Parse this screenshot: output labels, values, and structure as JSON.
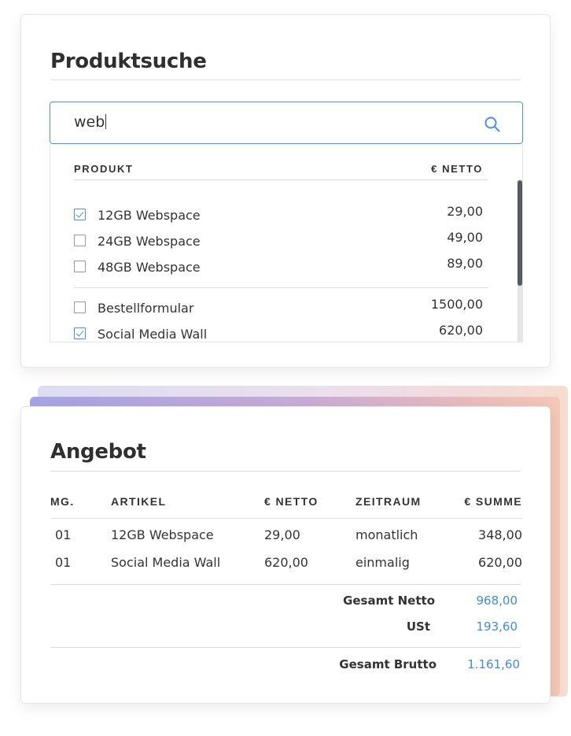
{
  "search": {
    "title": "Produktsuche",
    "query": "web",
    "columns": {
      "product": "PRODUKT",
      "price": "€ NETTO"
    },
    "results": [
      {
        "name": "12GB Webspace",
        "price": "29,00",
        "checked": true
      },
      {
        "name": "24GB Webspace",
        "price": "49,00",
        "checked": false
      },
      {
        "name": "48GB Webspace",
        "price": "89,00",
        "checked": false
      },
      {
        "name": "Bestellformular",
        "price": "1500,00",
        "checked": false
      },
      {
        "name": "Social Media Wall",
        "price": "620,00",
        "checked": true
      }
    ]
  },
  "offer": {
    "title": "Angebot",
    "columns": {
      "qty": "MG.",
      "article": "ARTIKEL",
      "net": "€ NETTO",
      "period": "ZEITRAUM",
      "sum": "€ SUMME"
    },
    "rows": [
      {
        "qty": "01",
        "article": "12GB Webspace",
        "net": "29,00",
        "period": "monatlich",
        "sum": "348,00"
      },
      {
        "qty": "01",
        "article": "Social Media Wall",
        "net": "620,00",
        "period": "einmalig",
        "sum": "620,00"
      }
    ],
    "totals": {
      "net_label": "Gesamt Netto",
      "net_value": "968,00",
      "vat_label": "USt",
      "vat_value": "193,60",
      "gross_label": "Gesamt Brutto",
      "gross_value": "1.161,60"
    }
  },
  "colors": {
    "accent": "#4a8fe0",
    "value_blue": "#3f8be0",
    "scrollbar": "#555a60"
  }
}
